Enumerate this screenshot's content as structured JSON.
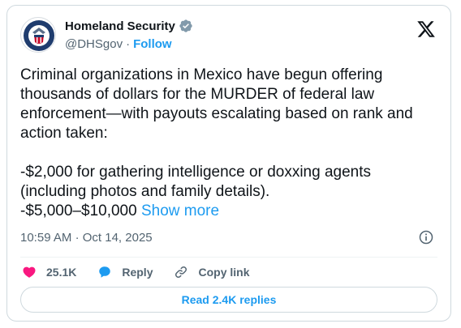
{
  "account": {
    "display_name": "Homeland Security",
    "handle": "@DHSgov",
    "separator": "·",
    "follow_label": "Follow",
    "verified_color": "#829aab"
  },
  "tweet": {
    "paragraph_1": "Criminal organizations in Mexico have begun offering thousands of dollars for the MURDER of federal law enforcement—with payouts escalating based on rank and action taken:",
    "paragraph_2": "-$2,000 for gathering intelligence or doxxing agents (including photos and family details).",
    "paragraph_3_start": "-$5,000–$10,000 ",
    "show_more_label": "Show more"
  },
  "meta": {
    "time": "10:59 AM",
    "separator": "·",
    "date": "Oct 14, 2025"
  },
  "actions": {
    "like_count": "25.1K",
    "reply_label": "Reply",
    "copy_link_label": "Copy link"
  },
  "read_replies_label": "Read 2.4K replies",
  "colors": {
    "accent": "#1d9bf0",
    "like": "#f91880",
    "muted": "#536471",
    "border": "#cfd9de"
  }
}
